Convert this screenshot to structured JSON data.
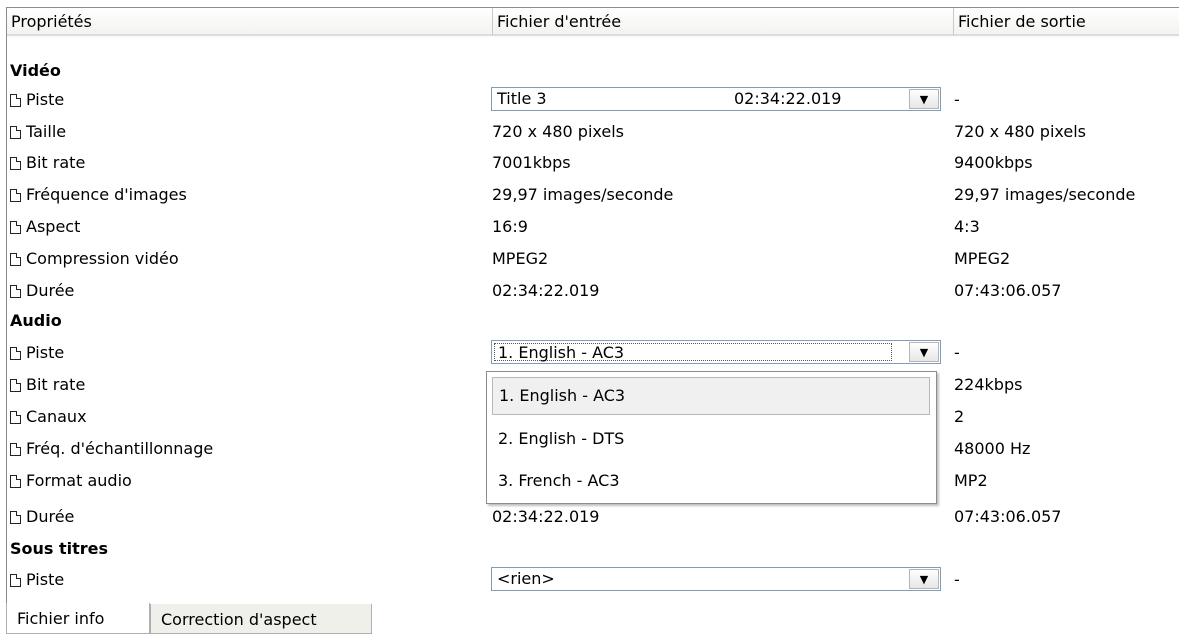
{
  "columns": [
    "Propriétés",
    "Fichier d'entrée",
    "Fichier de sortie"
  ],
  "sections": {
    "video": {
      "label": "Vidéo",
      "rows": [
        {
          "prop": "Piste",
          "input_title": "Title 3",
          "input_extra": "02:34:22.019",
          "output": "-"
        },
        {
          "prop": "Taille",
          "input": "720 x 480 pixels",
          "output": "720 x 480 pixels"
        },
        {
          "prop": "Bit rate",
          "input": "7001kbps",
          "output": "9400kbps"
        },
        {
          "prop": "Fréquence d'images",
          "input": "29,97 images/seconde",
          "output": "29,97 images/seconde"
        },
        {
          "prop": "Aspect",
          "input": "16:9",
          "output": "4:3"
        },
        {
          "prop": "Compression vidéo",
          "input": "MPEG2",
          "output": "MPEG2"
        },
        {
          "prop": "Durée",
          "input": "02:34:22.019",
          "output": "07:43:06.057"
        }
      ]
    },
    "audio": {
      "label": "Audio",
      "rows": [
        {
          "prop": "Piste",
          "input": "1. English - AC3",
          "output": "-"
        },
        {
          "prop": "Bit rate",
          "input": "",
          "output": "224kbps"
        },
        {
          "prop": "Canaux",
          "input": "",
          "output": "2"
        },
        {
          "prop": "Fréq. d'échantillonnage",
          "input": "",
          "output": "48000 Hz"
        },
        {
          "prop": "Format audio",
          "input": "",
          "output": "MP2"
        },
        {
          "prop": "Durée",
          "input": "02:34:22.019",
          "output": "07:43:06.057"
        }
      ]
    },
    "subtitles": {
      "label": "Sous titres",
      "rows": [
        {
          "prop": "Piste",
          "input": "<rien>",
          "output": "-"
        }
      ]
    }
  },
  "audio_dropdown": {
    "options": [
      "1. English - AC3",
      "2. English - DTS",
      "3. French - AC3"
    ],
    "selected": "1. English - AC3"
  },
  "tabs": [
    "Fichier info",
    "Correction d'aspect"
  ],
  "active_tab": "Fichier info"
}
